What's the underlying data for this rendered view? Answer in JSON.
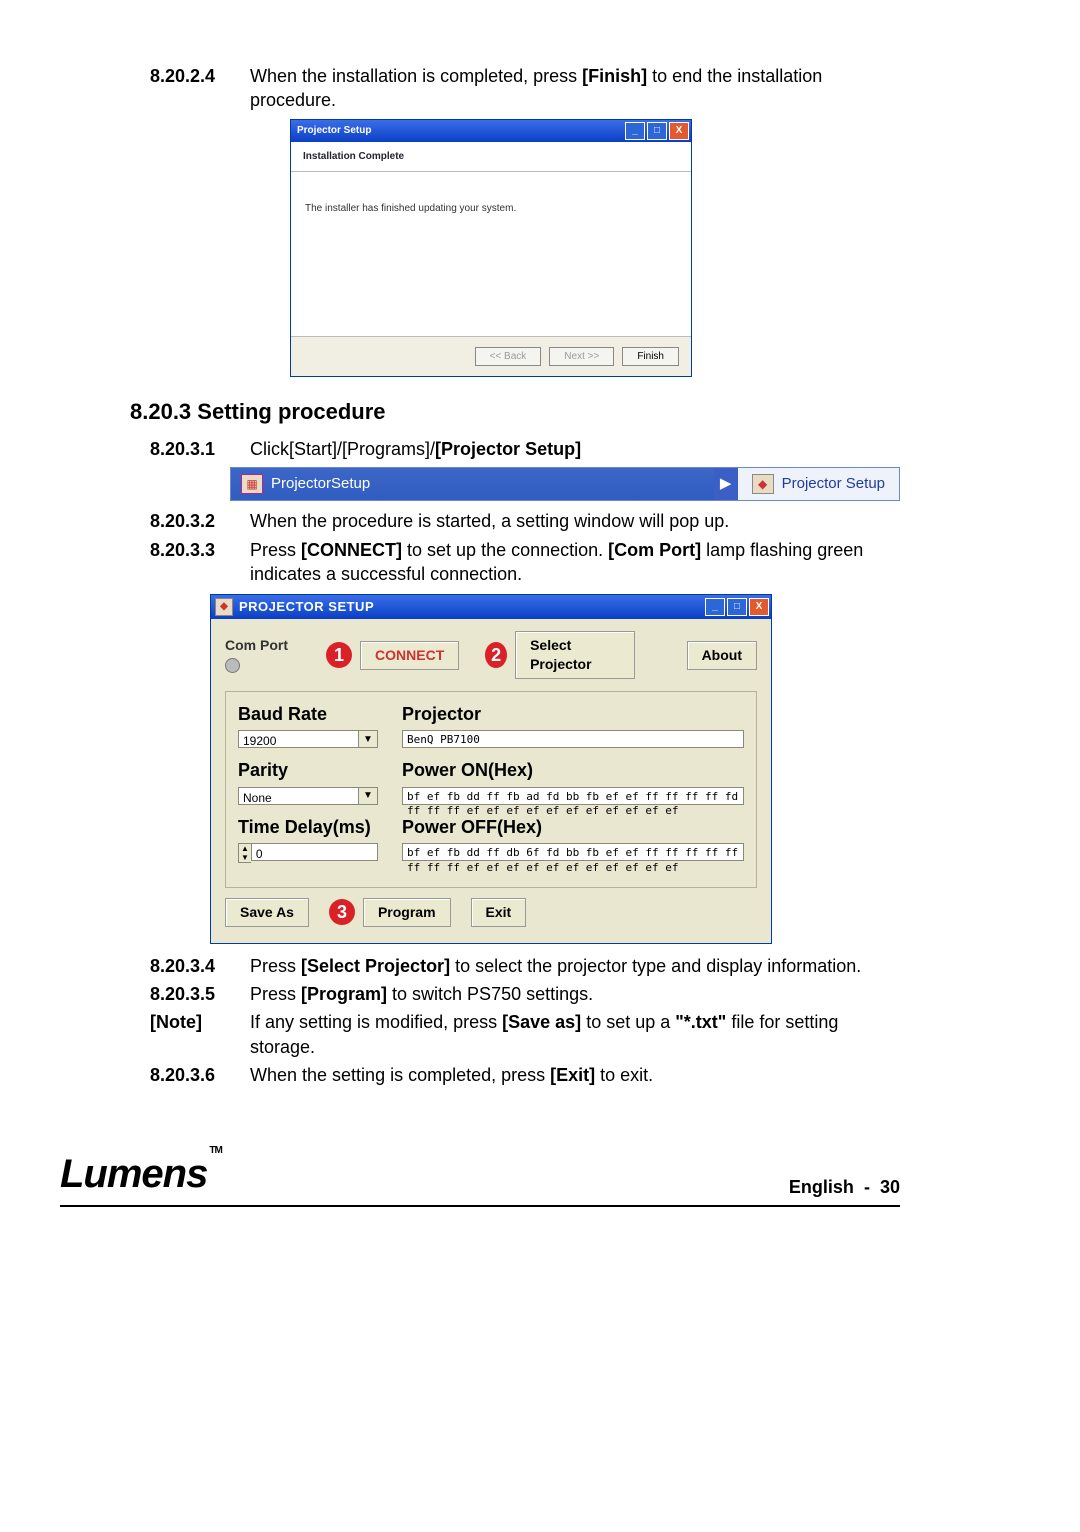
{
  "step_8_20_2_4": {
    "num": "8.20.2.4",
    "pre": "When the installation is completed, press ",
    "bold": "[Finish]",
    "post": " to end the installation procedure."
  },
  "installer": {
    "title": "Projector Setup",
    "heading": "Installation Complete",
    "body": "The installer has finished updating your system.",
    "back": "<< Back",
    "next": "Next >>",
    "finish": "Finish"
  },
  "h_8_20_3": "8.20.3  Setting procedure",
  "step_8_20_3_1": {
    "num": "8.20.3.1",
    "pre": "Click[Start]/[Programs]/",
    "bold": "[Projector Setup]"
  },
  "startmenu": {
    "folder": "ProjectorSetup",
    "arrow": "▶",
    "item": "Projector Setup"
  },
  "step_8_20_3_2": {
    "num": "8.20.3.2",
    "txt": "When the procedure is started, a setting window will pop up."
  },
  "step_8_20_3_3": {
    "num": "8.20.3.3",
    "pre": "Press ",
    "b1": "[CONNECT]",
    "mid": " to set up the connection. ",
    "b2": "[Com Port]",
    "post": " lamp flashing green indicates a successful connection."
  },
  "ps": {
    "title": "PROJECTOR SETUP",
    "comport": "Com Port",
    "connect": "CONNECT",
    "select": "Select Projector",
    "about": "About",
    "baud_l": "Baud Rate",
    "baud_v": "19200",
    "proj_l": "Projector",
    "proj_v": "BenQ PB7100",
    "parity_l": "Parity",
    "parity_v": "None",
    "pon_l": "Power ON(Hex)",
    "pon_v": "bf ef fb dd ff fb ad fd bb fb ef ef ff ff ff ff fd ff ff ff ef ef ef ef ef ef ef ef ef ef ef",
    "delay_l": "Time Delay(ms)",
    "delay_v": "0",
    "poff_l": "Power OFF(Hex)",
    "poff_v": "bf ef fb dd ff db 6f fd bb fb ef ef ff ff ff ff ff ff ff ff ef ef ef ef ef ef ef ef ef ef ef",
    "saveas": "Save As",
    "program": "Program",
    "exit": "Exit",
    "c1": "1",
    "c2": "2",
    "c3": "3"
  },
  "step_8_20_3_4": {
    "num": "8.20.3.4",
    "pre": "Press ",
    "bold": "[Select Projector]",
    "post": " to select the projector type and display information."
  },
  "step_8_20_3_5": {
    "num": "8.20.3.5",
    "pre": "Press ",
    "bold": "[Program]",
    "post": " to switch PS750 settings."
  },
  "note": {
    "num": "[Note]",
    "pre": "If any setting is modified, press ",
    "b1": "[Save as]",
    "mid": " to set up a ",
    "b2": "\"*.txt\"",
    "post": " file for setting storage."
  },
  "step_8_20_3_6": {
    "num": "8.20.3.6",
    "pre": "When the setting is completed, press ",
    "bold": "[Exit]",
    "post": " to exit."
  },
  "footer": {
    "logo": "Lumens",
    "tm": "TM",
    "lang": "English",
    "dash": "-",
    "page": "30"
  }
}
